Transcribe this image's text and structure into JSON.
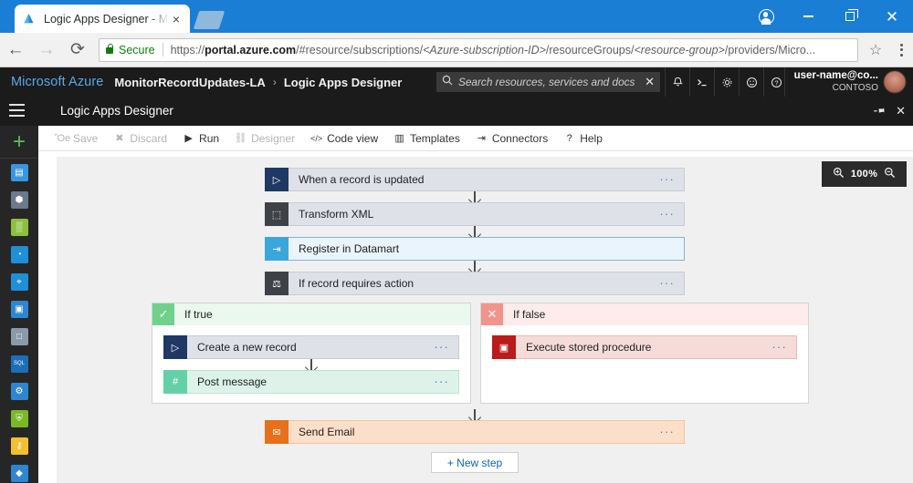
{
  "browser": {
    "tab": {
      "title": "Logic Apps Designer - M",
      "favicon": "azure-logo-icon",
      "close": "×"
    },
    "nav": {
      "back": "←",
      "forward": "→",
      "reload": "⟳"
    },
    "omnibox": {
      "secure_label": "Secure",
      "url_scheme": "https://",
      "url_host": "portal.azure.com",
      "url_path_1": "/#resource/subscriptions/",
      "url_ph_1": "<Azure-subscription-ID>",
      "url_path_2": "/resourceGroups/",
      "url_ph_2": "<resource-group>",
      "url_path_3": "/providers/Micro...",
      "bookmark": "☆",
      "menu": "kebab-menu-icon"
    },
    "window": {
      "profile": "profile-icon",
      "minimize": "–",
      "maximize": "restore-icon",
      "close": "✕"
    }
  },
  "azure_nav": {
    "brand": "Microsoft Azure",
    "breadcrumb": [
      {
        "label": "MonitorRecordUpdates-LA"
      },
      {
        "label": "Logic Apps Designer"
      }
    ],
    "breadcrumb_separator": "›",
    "search": {
      "placeholder": "Search resources, services and docs",
      "clear": "✕"
    },
    "icons": [
      {
        "name": "notifications-bell-icon",
        "glyph": "ὑ4"
      },
      {
        "name": "cloud-shell-icon",
        "glyph": ">_"
      },
      {
        "name": "settings-gear-icon",
        "glyph": "⚙"
      },
      {
        "name": "feedback-smiley-icon",
        "glyph": "☺"
      },
      {
        "name": "help-question-icon",
        "glyph": "?"
      }
    ],
    "user": {
      "name": "user-name@co...",
      "org": "CONTOSO"
    }
  },
  "blade": {
    "title": "Logic Apps Designer",
    "pin": "✓",
    "close": "✕"
  },
  "rail": {
    "new_label": "+",
    "items": [
      {
        "name": "dashboard-icon",
        "color": "#3a96dd",
        "glyph": "▤"
      },
      {
        "name": "resource-groups-icon",
        "color": "#6b7a8c",
        "glyph": "⬢"
      },
      {
        "name": "all-resources-icon",
        "color": "#8cbf3f",
        "glyph": "▒"
      },
      {
        "name": "recent-clock-icon",
        "color": "#1f8fd8",
        "glyph": "◔"
      },
      {
        "name": "navigate-compass-icon",
        "color": "#1f8fd8",
        "glyph": "⌖"
      },
      {
        "name": "app-services-icon",
        "color": "#2f86d0",
        "glyph": "▣"
      },
      {
        "name": "virtual-machines-icon",
        "color": "#8a9aa8",
        "glyph": "□"
      },
      {
        "name": "sql-databases-icon",
        "color": "#1b6fb8",
        "glyph": "SQL"
      },
      {
        "name": "subscriptions-cogs-icon",
        "color": "#2f86d0",
        "glyph": "⚙"
      },
      {
        "name": "security-center-icon",
        "color": "#7ab828",
        "glyph": "⛨"
      },
      {
        "name": "key-vault-icon",
        "color": "#f2c12e",
        "glyph": "⚷"
      },
      {
        "name": "logic-apps-icon",
        "color": "#2f86d0",
        "glyph": "◆"
      }
    ]
  },
  "toolbar": {
    "items": [
      {
        "label": "Save",
        "icon": "save-disk-icon",
        "glyph": "Ὃe",
        "disabled": true
      },
      {
        "label": "Discard",
        "icon": "discard-x-icon",
        "glyph": "✖",
        "disabled": true
      },
      {
        "label": "Run",
        "icon": "run-play-icon",
        "glyph": "▶",
        "disabled": false
      },
      {
        "label": "Designer",
        "icon": "designer-icon",
        "glyph": "⛓",
        "disabled": true
      },
      {
        "label": "Code view",
        "icon": "code-view-icon",
        "glyph": "</>",
        "disabled": false
      },
      {
        "label": "Templates",
        "icon": "templates-icon",
        "glyph": "▥",
        "disabled": false
      },
      {
        "label": "Connectors",
        "icon": "connectors-icon",
        "glyph": "⇥",
        "disabled": false
      },
      {
        "label": "Help",
        "icon": "help-icon",
        "glyph": "?",
        "disabled": false
      }
    ]
  },
  "canvas": {
    "zoom": {
      "zoom_in": "zoom-in-icon",
      "level": "100%",
      "zoom_out": "zoom-out-icon"
    },
    "steps": [
      {
        "label": "When a record is updated",
        "icon": "dynamics-trigger-icon",
        "icon_bg": "#1f3864",
        "icon_glyph": "▷",
        "style": "",
        "ellipsis": "···"
      },
      {
        "label": "Transform XML",
        "icon": "transform-xml-icon",
        "icon_bg": "#3e4146",
        "icon_glyph": "⬚",
        "style": "",
        "ellipsis": "···"
      },
      {
        "label": "Register in Datamart",
        "icon": "register-datamart-icon",
        "icon_bg": "#3aa7dc",
        "icon_glyph": "⇥",
        "style": "sel",
        "ellipsis": ""
      },
      {
        "label": "If record requires action",
        "icon": "condition-icon",
        "icon_bg": "#3e4146",
        "icon_glyph": "⚖",
        "style": "",
        "ellipsis": "···"
      }
    ],
    "branch_true": {
      "title": "If true",
      "badge": "✓",
      "badge_name": "checkmark-icon",
      "actions": [
        {
          "label": "Create a new record",
          "icon": "dynamics-create-record-icon",
          "icon_bg": "#1f3864",
          "icon_glyph": "▷",
          "style": "",
          "ellipsis": "···"
        },
        {
          "label": "Post message",
          "icon": "slack-post-message-icon",
          "icon_bg": "#63d0a8",
          "icon_glyph": "#",
          "style": "mint",
          "ellipsis": "···"
        }
      ]
    },
    "branch_false": {
      "title": "If false",
      "badge": "✕",
      "badge_name": "cross-icon",
      "actions": [
        {
          "label": "Execute stored procedure",
          "icon": "sql-stored-procedure-icon",
          "icon_bg": "#ba1b1b",
          "icon_glyph": "▣",
          "style": "pink",
          "ellipsis": "···"
        }
      ]
    },
    "final_step": {
      "label": "Send Email",
      "icon": "outlook-send-email-icon",
      "icon_bg": "#e8701a",
      "icon_glyph": "✉",
      "style": "peach",
      "ellipsis": "···"
    },
    "new_step_button": "+ New step"
  }
}
